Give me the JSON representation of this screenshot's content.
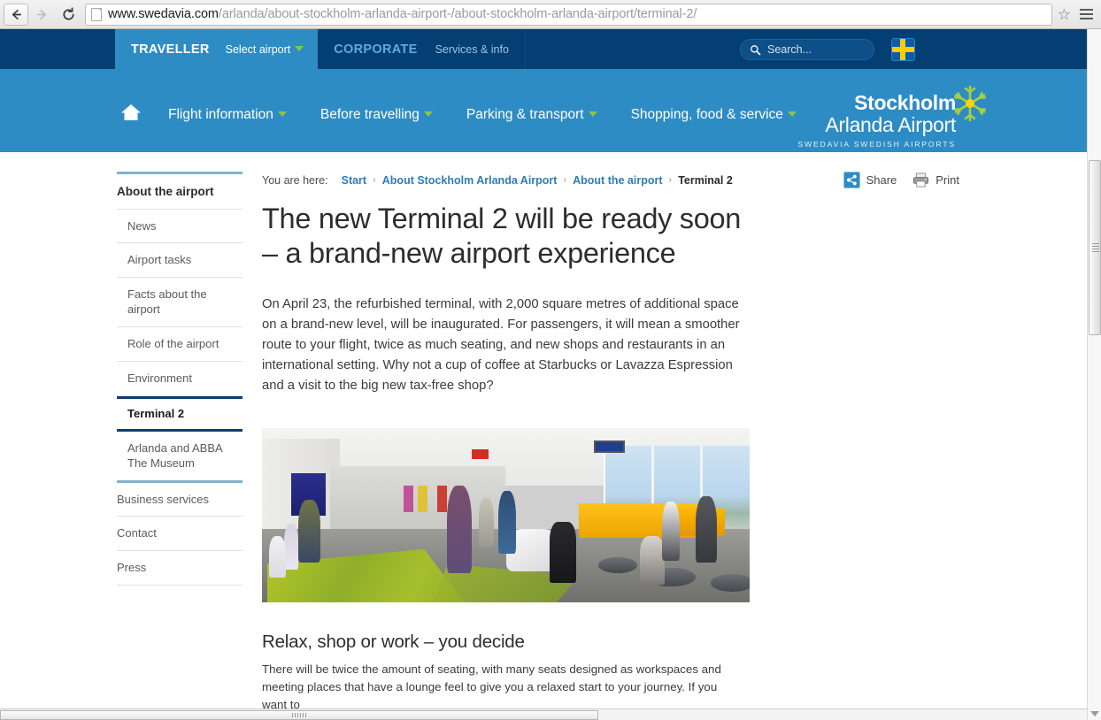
{
  "browser": {
    "back_icon": "back-arrow-icon",
    "forward_icon": "forward-arrow-icon",
    "reload_icon": "reload-icon",
    "reload_glyph": "↻",
    "url_host": "www.swedavia.com",
    "url_path": "/arlanda/about-stockholm-arlanda-airport-/about-stockholm-arlanda-airport/terminal-2/",
    "star_glyph": "☆",
    "menu_icon": "hamburger-menu-icon"
  },
  "utility_bar": {
    "traveller_label": "TRAVELLER",
    "select_airport_label": "Select airport",
    "corporate_label": "CORPORATE",
    "services_info_label": "Services & info",
    "search_placeholder": "Search...",
    "flag_icon": "swedish-flag-icon"
  },
  "main_nav": {
    "home_icon": "home-icon",
    "items": [
      {
        "label": "Flight information",
        "caret": true
      },
      {
        "label": "Before travelling",
        "caret": true
      },
      {
        "label": "Parking & transport",
        "caret": true
      },
      {
        "label": "Shopping, food & service",
        "caret": true
      }
    ],
    "logo_line1": "Stockholm",
    "logo_line2": "Arlanda Airport",
    "logo_tagline": "SWEDAVIA SWEDISH AIRPORTS",
    "snowflake_icon": "snowflake-icon"
  },
  "sidebar": {
    "items": [
      {
        "label": "About the airport",
        "level": "root",
        "active": false
      },
      {
        "label": "News",
        "level": "sub",
        "active": false
      },
      {
        "label": "Airport tasks",
        "level": "sub",
        "active": false
      },
      {
        "label": "Facts about the airport",
        "level": "sub",
        "active": false
      },
      {
        "label": "Role of the airport",
        "level": "sub",
        "active": false
      },
      {
        "label": "Environment",
        "level": "sub",
        "active": false
      },
      {
        "label": "Terminal 2",
        "level": "sub",
        "active": true
      },
      {
        "label": "Arlanda and ABBA The Museum",
        "level": "sub",
        "active": false
      },
      {
        "label": "Business services",
        "level": "root2",
        "active": false
      },
      {
        "label": "Contact",
        "level": "root2",
        "active": false
      },
      {
        "label": "Press",
        "level": "root2",
        "active": false
      }
    ]
  },
  "breadcrumb": {
    "label": "You are here:",
    "sep": "›",
    "items": [
      "Start",
      "About Stockholm Arlanda Airport",
      "About the airport"
    ],
    "current": "Terminal 2"
  },
  "page_tools": {
    "share_label": "Share",
    "share_icon": "share-icon",
    "print_label": "Print",
    "print_icon": "printer-icon"
  },
  "article": {
    "headline": "The new Terminal 2 will be ready soon – a brand-new airport experience",
    "intro": "On April 23, the refurbished terminal, with 2,000 square metres of additional space on a brand-new level, will be inaugurated. For passengers, it will mean a smoother route to your flight, twice as much seating, and new shops and restaurants in an international setting. Why not a cup of coffee at Starbucks or Lavazza Espression and a visit to the big new tax-free shop?",
    "photo_alt": "terminal-lounge-rendering",
    "subheading": "Relax, shop or work – you decide",
    "body": "There will be twice the amount of seating, with many seats designed as workspaces and meeting places that have a lounge feel to give you a relaxed start to your journey. If you want to"
  },
  "scrollbars": {
    "vertical_thumb_name": "vertical-scrollbar-thumb",
    "horizontal_thumb_name": "horizontal-scrollbar-thumb"
  },
  "colors": {
    "navy": "#033f73",
    "blue": "#2e8cc4",
    "link_blue": "#2e7cb8",
    "accent_green": "#8cc63e",
    "flag_yellow": "#ffcc00"
  }
}
